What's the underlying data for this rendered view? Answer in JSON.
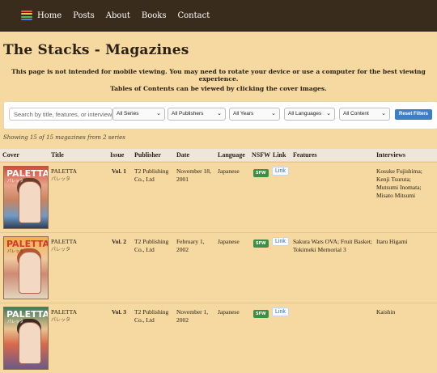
{
  "nav": {
    "items": [
      {
        "label": "Home"
      },
      {
        "label": "Posts"
      },
      {
        "label": "About"
      },
      {
        "label": "Books"
      },
      {
        "label": "Contact"
      }
    ],
    "logo_colors": [
      "#ef5a4a",
      "#f3c54a",
      "#4dbb63",
      "#4a86d8"
    ]
  },
  "page": {
    "title": "The Stacks - Magazines",
    "notice": "This page is not intended for mobile viewing. You may need to rotate your device or use a computer for the best viewing experience.",
    "toc_hint": "Tables of Contents can be viewed by clicking the cover images."
  },
  "filters": {
    "search_placeholder": "Search by title, features, or interview",
    "series": "All Series",
    "publishers": "All Publishers",
    "years": "All Years",
    "languages": "All Languages",
    "content": "All Content",
    "reset_label": "Reset Filters"
  },
  "results": {
    "summary": "Showing 15 of 15 magazines from 2 series"
  },
  "table": {
    "headers": {
      "cover": "Cover",
      "title": "Title",
      "issue": "Issue",
      "publisher": "Publisher",
      "date": "Date",
      "language": "Language",
      "nsfw": "NSFW",
      "link": "Link",
      "features": "Features",
      "interviews": "Interviews"
    },
    "rows": [
      {
        "cover_title": "PALETTA",
        "cover_subtitle": "パレッタ",
        "title": "PALETTA",
        "title_jp": "パレッタ",
        "issue": "Vol. 1",
        "publisher": "T2 Publishing Co., Ltd",
        "date": "November 18, 2001",
        "language": "Japanese",
        "nsfw": "SFW",
        "link": "Link",
        "features": "",
        "interviews": "Kosuke Fujishima; Kenji Tsuruta; Mutsumi Inomata; Misato Mitsumi"
      },
      {
        "cover_title": "PALETTA",
        "cover_subtitle": "パレッタ",
        "title": "PALETTA",
        "title_jp": "パレッタ",
        "issue": "Vol. 2",
        "publisher": "T2 Publishing Co., Ltd",
        "date": "February 1, 2002",
        "language": "Japanese",
        "nsfw": "SFW",
        "link": "Link",
        "features": "Sakura Wars OVA; Fruit Basket; Tokimeki Memorial 3",
        "interviews": "Itaru Higami"
      },
      {
        "cover_title": "PALETTA",
        "cover_subtitle": "パレッタ",
        "title": "PALETTA",
        "title_jp": "パレッタ",
        "issue": "Vol. 3",
        "publisher": "T2 Publishing Co., Ltd",
        "date": "November 1, 2002",
        "language": "Japanese",
        "nsfw": "SFW",
        "link": "Link",
        "features": "",
        "interviews": "Kaishin"
      }
    ]
  }
}
